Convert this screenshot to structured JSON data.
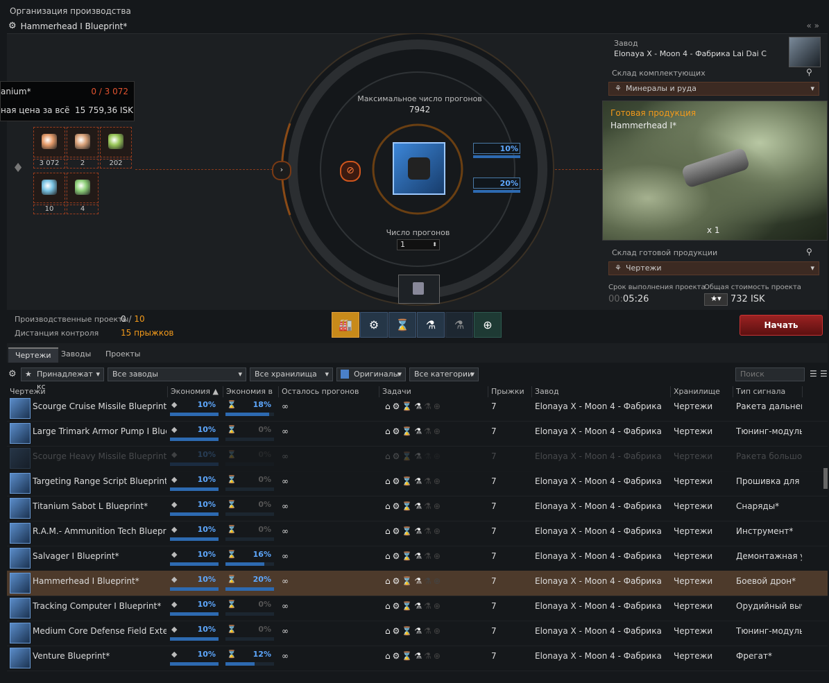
{
  "window": {
    "title": "Организация производства",
    "blueprint_title": "Hammerhead I Blueprint*",
    "nav_arrows": "« »"
  },
  "tooltip": {
    "material_name": "anium*",
    "material_count": "0 / 3 072",
    "price_label": "ная цена за всё",
    "price_value": "15 759,36 ISK"
  },
  "materials": [
    {
      "qty": "3 072",
      "color": "#e59b6a"
    },
    {
      "qty": "2",
      "color": "#d9a27a"
    },
    {
      "qty": "202",
      "color": "#9ac75a"
    },
    {
      "qty": "10",
      "color": "#7ac3e3"
    },
    {
      "qty": "4",
      "color": "#8fd07a"
    }
  ],
  "center": {
    "max_runs_label": "Максимальное число прогонов",
    "max_runs_value": "7942",
    "runs_label": "Число прогонов",
    "runs_value": "1",
    "me_value": "10%",
    "te_value": "20%"
  },
  "facility": {
    "label": "Завод",
    "name": "Elonaya X - Moon 4 - Фабрика Lai Dai C",
    "input_label": "Склад комплектующих",
    "input_value": "Минералы и руда",
    "output_label_top": "Готовая продукция",
    "product_name": "Hammerhead I*",
    "product_qty": "x 1",
    "output_label": "Склад готовой продукции",
    "output_value": "Чертежи",
    "duration_label": "Срок выполнения проекта",
    "duration_value_dim": "00:",
    "duration_value": "05:26",
    "cost_label": "Общая стоимость проекта",
    "cost_value": "732 ISK"
  },
  "status": {
    "jobs_label": "Производственные проекты",
    "jobs_current": "0",
    "jobs_sep": "/",
    "jobs_max": "10",
    "range_label": "Дистанция контроля",
    "range_value": "15 прыжков",
    "start_button": "Начать"
  },
  "tabs": [
    "Чертежи",
    "Заводы",
    "Проекты"
  ],
  "filters": {
    "owner": "Принадлежат кс",
    "facilities": "Все заводы",
    "storages": "Все хранилища",
    "type": "Оригиналы",
    "categories": "Все категории",
    "search_placeholder": "Поиск"
  },
  "columns": [
    "Чертежи",
    "Экономия ▲",
    "Экономия в",
    "Осталось прогонов",
    "Задачи",
    "Прыжки",
    "Завод",
    "Хранилище",
    "Тип сигнала"
  ],
  "rows": [
    {
      "name": "Scourge Cruise Missile Blueprint*",
      "me": "10%",
      "te": "18%",
      "te_frac": 0.9,
      "runs": "∞",
      "jumps": "7",
      "facility": "Elonaya X - Moon 4 - Фабрика",
      "storage": "Чертежи",
      "type": "Ракета дальнег",
      "faded": false,
      "selected": false
    },
    {
      "name": "Large Trimark Armor Pump I Blueprint*",
      "me": "10%",
      "te": "0%",
      "te_frac": 0,
      "runs": "∞",
      "jumps": "7",
      "facility": "Elonaya X - Moon 4 - Фабрика",
      "storage": "Чертежи",
      "type": "Тюнинг-модуль",
      "faded": false,
      "selected": false
    },
    {
      "name": "Scourge Heavy Missile Blueprint*",
      "me": "10%",
      "te": "0%",
      "te_frac": 0,
      "runs": "∞",
      "jumps": "7",
      "facility": "Elonaya X - Moon 4 - Фабрика",
      "storage": "Чертежи",
      "type": "Ракета большо",
      "faded": true,
      "selected": false
    },
    {
      "name": "Targeting Range Script Blueprint*",
      "me": "10%",
      "te": "0%",
      "te_frac": 0,
      "runs": "∞",
      "jumps": "7",
      "facility": "Elonaya X - Moon 4 - Фабрика",
      "storage": "Чертежи",
      "type": "Прошивка для",
      "faded": false,
      "selected": false
    },
    {
      "name": "Titanium Sabot L Blueprint*",
      "me": "10%",
      "te": "0%",
      "te_frac": 0,
      "runs": "∞",
      "jumps": "7",
      "facility": "Elonaya X - Moon 4 - Фабрика",
      "storage": "Чертежи",
      "type": "Снаряды*",
      "faded": false,
      "selected": false
    },
    {
      "name": "R.A.M.- Ammunition Tech Blueprint*",
      "me": "10%",
      "te": "0%",
      "te_frac": 0,
      "runs": "∞",
      "jumps": "7",
      "facility": "Elonaya X - Moon 4 - Фабрика",
      "storage": "Чертежи",
      "type": "Инструмент*",
      "faded": false,
      "selected": false
    },
    {
      "name": "Salvager I Blueprint*",
      "me": "10%",
      "te": "16%",
      "te_frac": 0.8,
      "runs": "∞",
      "jumps": "7",
      "facility": "Elonaya X - Moon 4 - Фабрика",
      "storage": "Чертежи",
      "type": "Демонтажная у",
      "faded": false,
      "selected": false
    },
    {
      "name": "Hammerhead I Blueprint*",
      "me": "10%",
      "te": "20%",
      "te_frac": 1.0,
      "runs": "∞",
      "jumps": "7",
      "facility": "Elonaya X - Moon 4 - Фабрика",
      "storage": "Чертежи",
      "type": "Боевой дрон*",
      "faded": false,
      "selected": true
    },
    {
      "name": "Tracking Computer I Blueprint*",
      "me": "10%",
      "te": "0%",
      "te_frac": 0,
      "runs": "∞",
      "jumps": "7",
      "facility": "Elonaya X - Moon 4 - Фабрика",
      "storage": "Чертежи",
      "type": "Орудийный выч",
      "faded": false,
      "selected": false
    },
    {
      "name": "Medium Core Defense Field Extender I Blueprint*",
      "me": "10%",
      "te": "0%",
      "te_frac": 0,
      "runs": "∞",
      "jumps": "7",
      "facility": "Elonaya X - Moon 4 - Фабрика",
      "storage": "Чертежи",
      "type": "Тюнинг-модуль",
      "faded": false,
      "selected": false
    },
    {
      "name": "Venture Blueprint*",
      "me": "10%",
      "te": "12%",
      "te_frac": 0.6,
      "runs": "∞",
      "jumps": "7",
      "facility": "Elonaya X - Moon 4 - Фабрика",
      "storage": "Чертежи",
      "type": "Фрегат*",
      "faded": false,
      "selected": false
    }
  ],
  "colors": {
    "accent_orange": "#f39a1b",
    "accent_blue": "#5ea8ff",
    "error_red": "#e2532f",
    "start_red": "#8b1a1a"
  }
}
